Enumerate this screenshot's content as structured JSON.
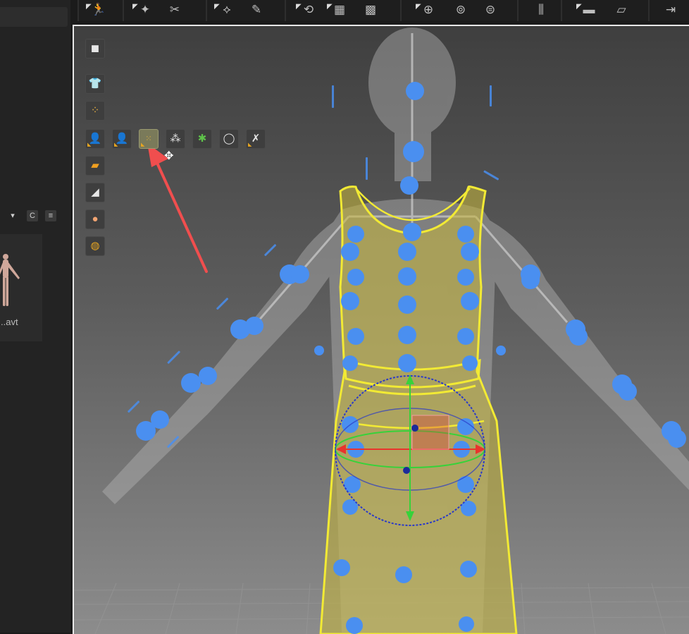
{
  "toolbar": {
    "groups": [
      {
        "icons": [
          "avatar-move-icon"
        ]
      },
      {
        "icons": [
          "garment-select-icon",
          "garment-transform-icon"
        ]
      },
      {
        "icons": [
          "pattern-edit-icon",
          "pattern-draw-icon"
        ]
      },
      {
        "icons": [
          "fold-arrangement-icon",
          "tack-icon",
          "tack-select-icon"
        ]
      },
      {
        "icons": [
          "button-add-icon",
          "button-select-icon",
          "buttonhole-icon"
        ]
      },
      {
        "icons": [
          "zipper-icon"
        ]
      },
      {
        "icons": [
          "tape-icon",
          "shirring-icon"
        ]
      },
      {
        "icons": [
          "pin-icon"
        ]
      }
    ]
  },
  "library": {
    "refresh_glyph": "C",
    "list_glyph": "≡",
    "dropdown_glyph": "▾",
    "thumbnail_label": "..avt"
  },
  "viewport_tools": [
    {
      "name": "display-avatar-tool",
      "icon": "cube-icon"
    },
    {
      "name": "show-garment-tool",
      "icon": "shirt-icon"
    },
    {
      "name": "arrangement-points-tool",
      "icon": "points-icon"
    },
    {
      "name": "show-avatar-tool",
      "icon": "avatar-icon",
      "sub": [
        {
          "name": "avatar-solid-tool",
          "icon": "avatar-solid-icon"
        },
        {
          "name": "avatar-points-tool",
          "icon": "avatar-points-icon",
          "active": true
        },
        {
          "name": "avatar-joints-tool",
          "icon": "avatar-joints-icon"
        },
        {
          "name": "avatar-skeleton-tool",
          "icon": "avatar-skeleton-icon"
        },
        {
          "name": "avatar-measure-tool",
          "icon": "avatar-measure-icon"
        },
        {
          "name": "avatar-pose-tool",
          "icon": "avatar-pose-icon"
        }
      ]
    },
    {
      "name": "texture-tool",
      "icon": "texture-icon"
    },
    {
      "name": "eraser-tool",
      "icon": "eraser-icon"
    },
    {
      "name": "skin-tool",
      "icon": "skin-icon"
    },
    {
      "name": "grid-sphere-tool",
      "icon": "globe-icon"
    }
  ],
  "colors": {
    "garment_fill": "#c8b83a",
    "garment_outline": "#f2ea34",
    "arrangement_point": "#4a8ff0",
    "avatar": "#a9a9a9",
    "annotation_arrow": "#f04e4e",
    "gizmo_x": "#e8342d",
    "gizmo_y": "#37d23a",
    "gizmo_z": "#2a39c8"
  }
}
